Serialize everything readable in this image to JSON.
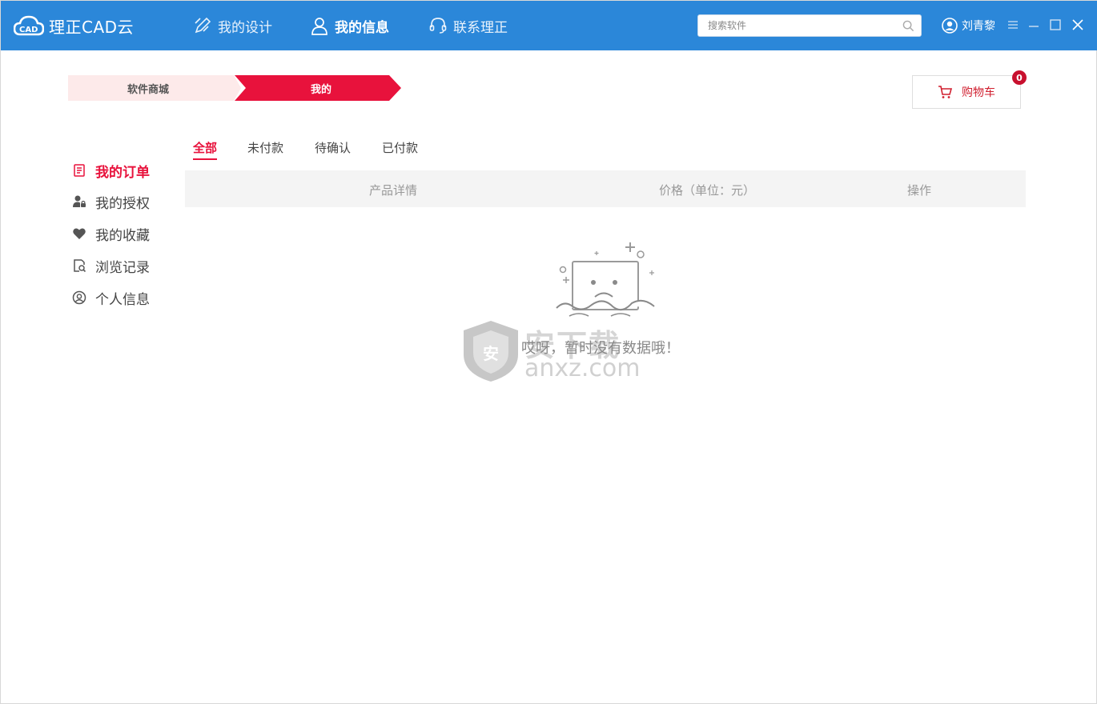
{
  "app": {
    "title": "理正CAD云"
  },
  "nav": {
    "design": "我的设计",
    "info": "我的信息",
    "contact": "联系理正"
  },
  "search": {
    "placeholder": "搜索软件"
  },
  "user": {
    "name": "刘青黎"
  },
  "breadcrumb": {
    "store": "软件商城",
    "mine": "我的"
  },
  "cart": {
    "label": "购物车",
    "count": "0"
  },
  "sidebar": {
    "items": [
      {
        "label": "我的订单"
      },
      {
        "label": "我的授权"
      },
      {
        "label": "我的收藏"
      },
      {
        "label": "浏览记录"
      },
      {
        "label": "个人信息"
      }
    ]
  },
  "tabs": [
    {
      "label": "全部"
    },
    {
      "label": "未付款"
    },
    {
      "label": "待确认"
    },
    {
      "label": "已付款"
    }
  ],
  "table": {
    "columns": [
      "产品详情",
      "价格（单位：元）",
      "操作"
    ]
  },
  "empty": {
    "message": "哎呀，暂时没有数据哦！"
  },
  "watermark": {
    "text": "安下载",
    "domain": "anxz.com",
    "shield": "安"
  },
  "colors": {
    "titlebar": "#2b87d9",
    "accent": "#e8123c"
  }
}
